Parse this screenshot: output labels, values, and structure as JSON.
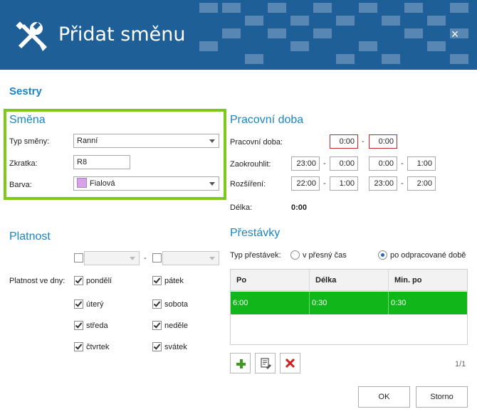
{
  "window": {
    "title": "Přidat směnu",
    "close_label": "×"
  },
  "section_name": "Sestry",
  "smena": {
    "title": "Směna",
    "typ_label": "Typ směny:",
    "typ_value": "Ranní",
    "zkratka_label": "Zkratka:",
    "zkratka_value": "R8",
    "barva_label": "Barva:",
    "barva_value": "Fialová",
    "barva_color": "#d8a2e8"
  },
  "pracovni_doba": {
    "title": "Pracovní doba",
    "doba_label": "Pracovní doba:",
    "doba_from": "0:00",
    "doba_to": "0:00",
    "zaokrouhlit_label": "Zaokrouhlit:",
    "zaokrouhlit": [
      "23:00",
      "0:00",
      "0:00",
      "1:00"
    ],
    "rozsireni_label": "Rozšíření:",
    "rozsireni": [
      "22:00",
      "1:00",
      "23:00",
      "2:00"
    ],
    "delka_label": "Délka:",
    "delka_value": "0:00",
    "separator": "-"
  },
  "platnost": {
    "title": "Platnost",
    "dny_label": "Platnost ve dny:",
    "days": [
      {
        "label": "pondělí",
        "checked": true
      },
      {
        "label": "úterý",
        "checked": true
      },
      {
        "label": "středa",
        "checked": true
      },
      {
        "label": "čtvrtek",
        "checked": true
      },
      {
        "label": "pátek",
        "checked": true
      },
      {
        "label": "sobota",
        "checked": true
      },
      {
        "label": "neděle",
        "checked": true
      },
      {
        "label": "svátek",
        "checked": true
      }
    ]
  },
  "prestavky": {
    "title": "Přestávky",
    "typ_label": "Typ přestávek:",
    "option_exact": "v přesný čas",
    "option_worked": "po odpracované době",
    "selected": "option_worked",
    "columns": [
      "Po",
      "Délka",
      "Min. po"
    ],
    "rows": [
      [
        "6:00",
        "0:30",
        "0:30"
      ]
    ],
    "pager": "1/1"
  },
  "buttons": {
    "ok": "OK",
    "cancel": "Storno"
  },
  "colors": {
    "header": "#1f5f98",
    "accent": "#1b84c3",
    "highlight_border": "#7dc91a",
    "selected_row": "#10b61a",
    "error_border": "#c22a2a"
  },
  "icons": [
    "wrench-screwdriver-icon",
    "close-icon",
    "add-icon",
    "edit-icon",
    "delete-icon"
  ]
}
